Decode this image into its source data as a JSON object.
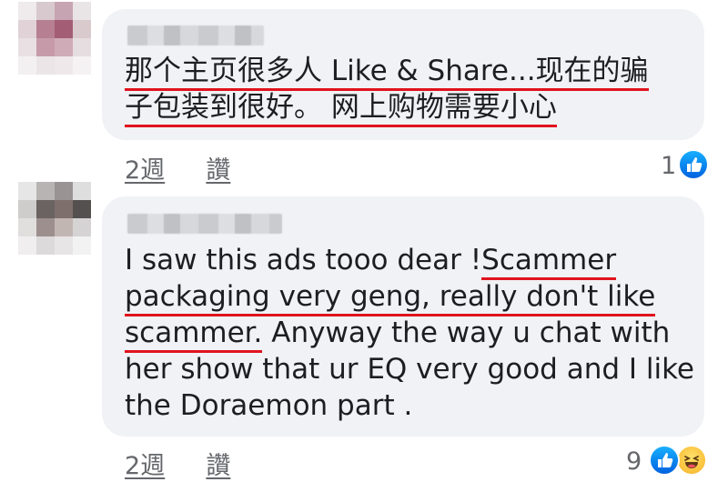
{
  "comments": [
    {
      "text_lines": [
        "那个主页很多人 Like & Share...现在的骗",
        "子包装到很好。 网上购物需要小心"
      ],
      "time": "2週",
      "action": "讚",
      "reaction_count": "1",
      "reactions": [
        "like-icon"
      ]
    },
    {
      "text_pre": "I saw this ads tooo dear !",
      "text_u1": "Scammer",
      "text_u2": "packaging very geng, really don't like",
      "text_u3": "scammer.",
      "text_post": " Anyway the way u chat with",
      "text_line4": "her show that ur EQ very good and I like",
      "text_line5": "the Doraemon part .",
      "time": "2週",
      "action": "讚",
      "reaction_count": "9",
      "reactions": [
        "like-icon",
        "haha-icon"
      ]
    }
  ],
  "colors": {
    "bubble": "#f0f2f5",
    "underline": "#e0131e",
    "like": "#1877f2",
    "haha": "#f7b125",
    "meta": "#65676b"
  }
}
